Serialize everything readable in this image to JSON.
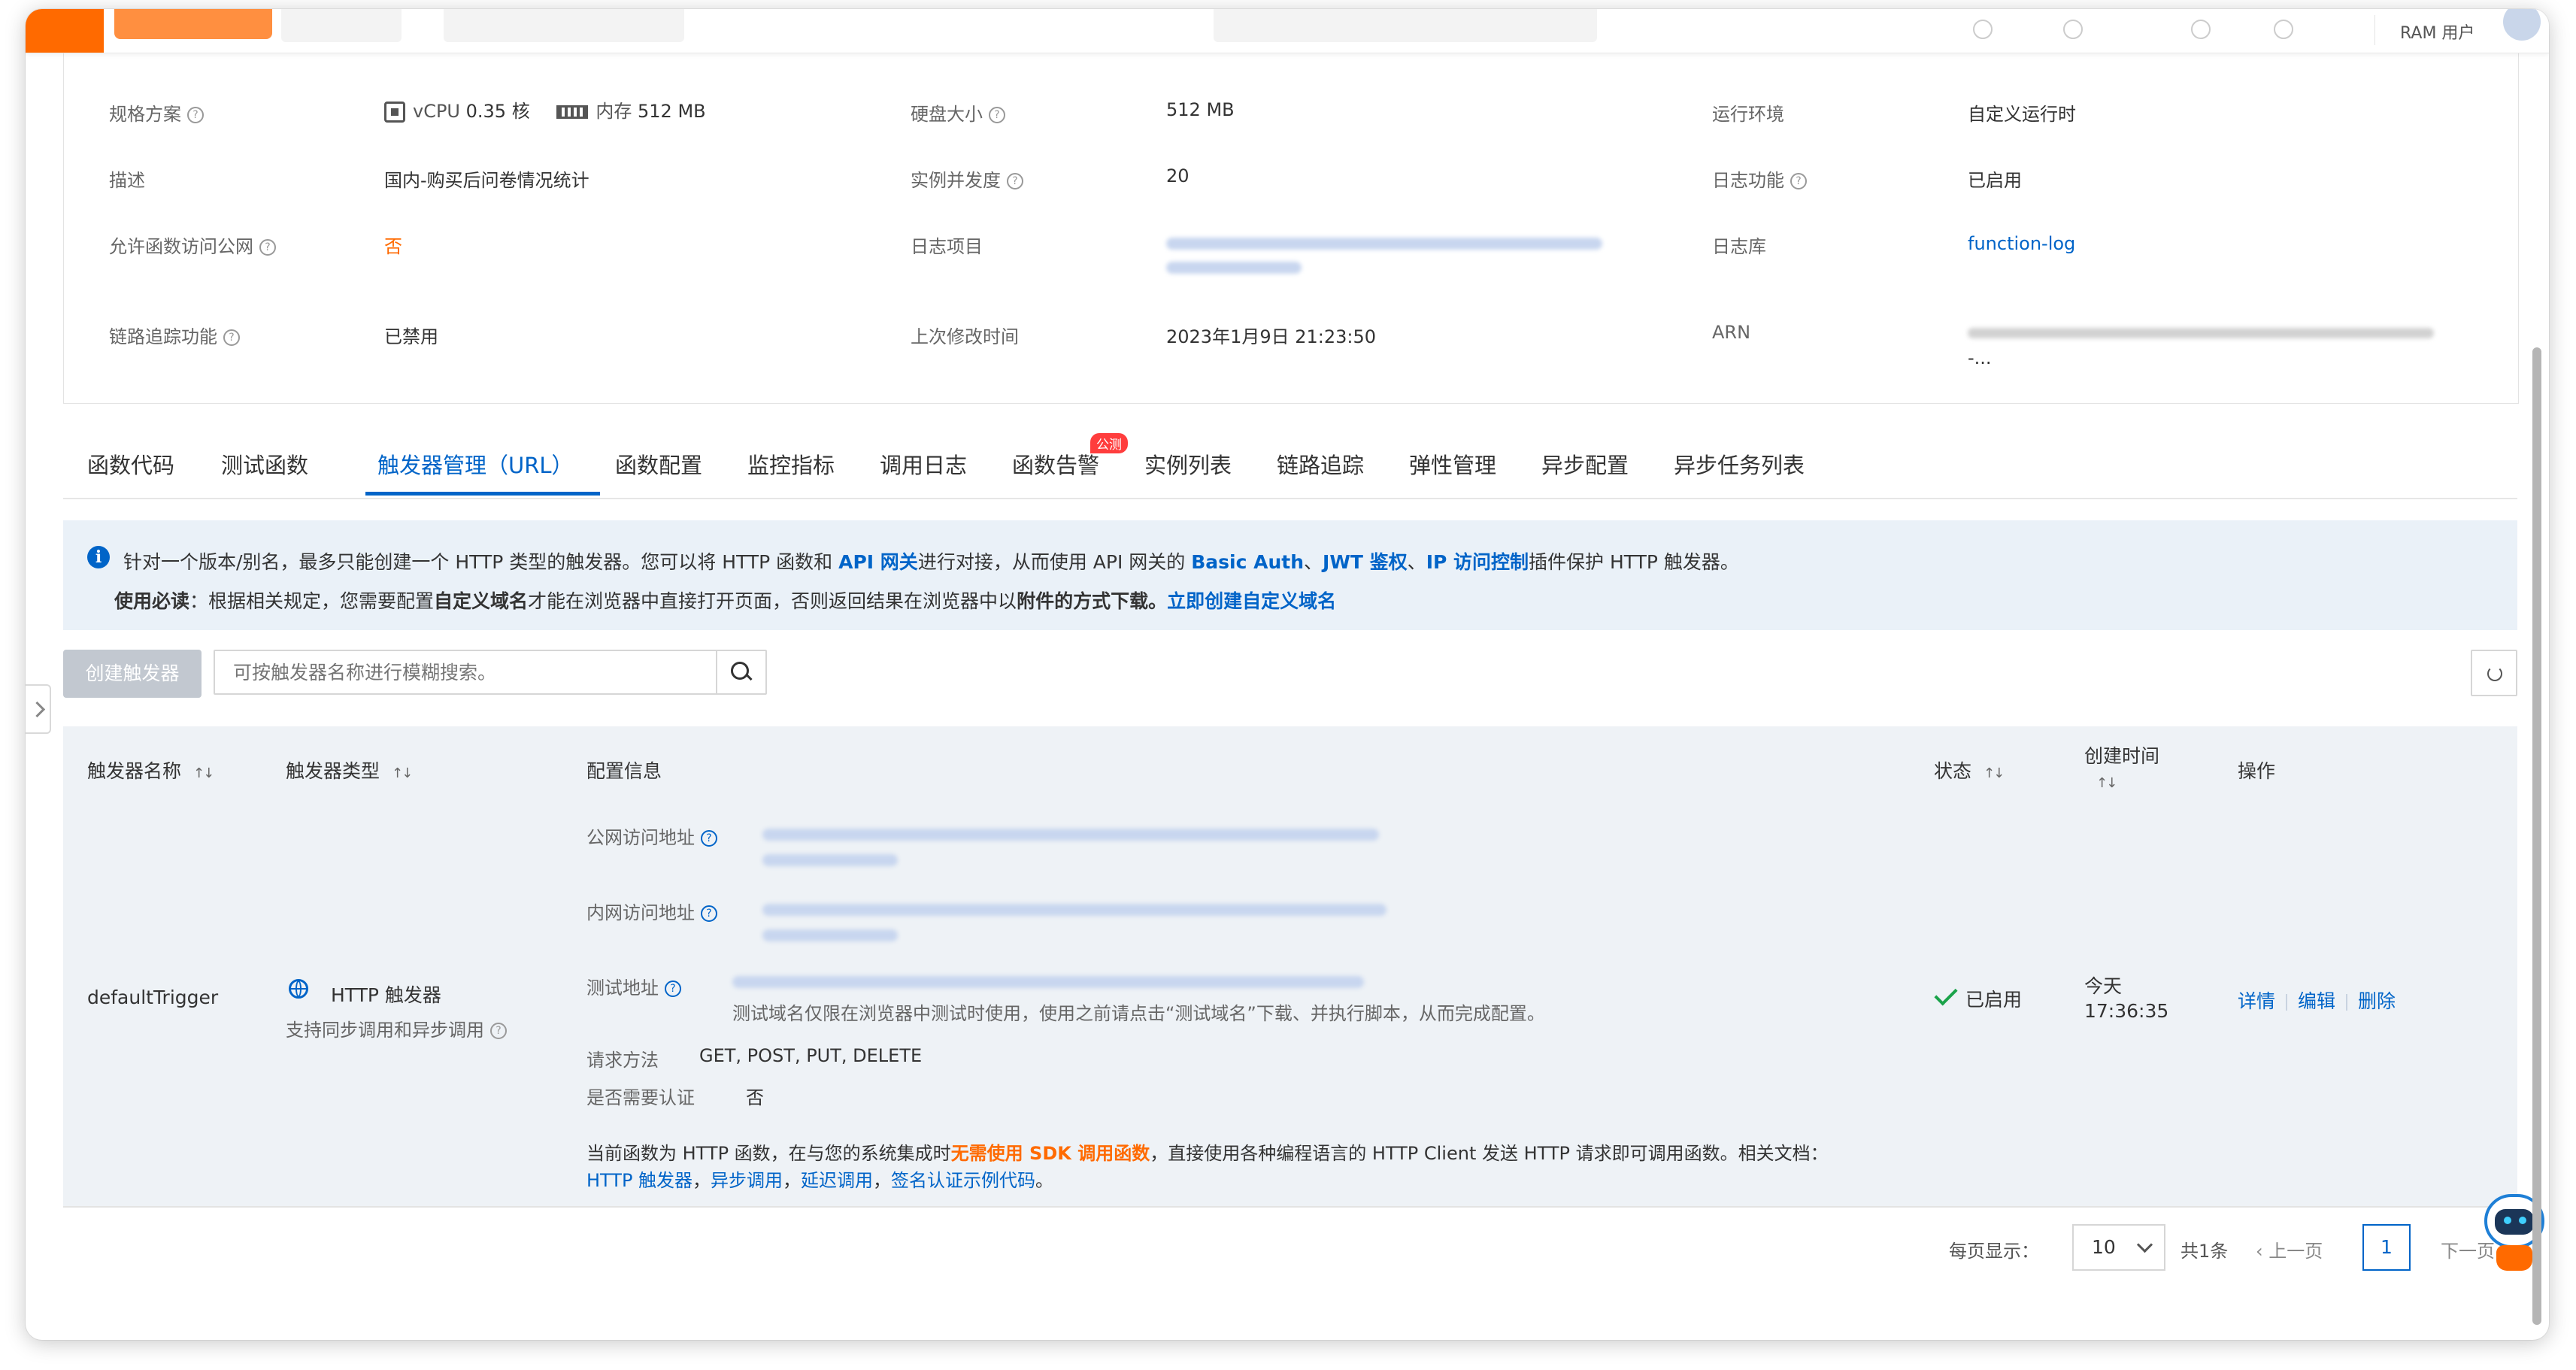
{
  "topbar": {
    "ram_user": "RAM 用户"
  },
  "info": {
    "spec_label": "规格方案",
    "vcpu_text": "vCPU",
    "vcpu_value": "0.35 核",
    "mem_text": "内存",
    "mem_value": "512 MB",
    "disk_label": "硬盘大小",
    "disk_value": "512 MB",
    "runtime_label": "运行环境",
    "runtime_value": "自定义运行时",
    "desc_label": "描述",
    "desc_value": "国内-购买后问卷情况统计",
    "concurrency_label": "实例并发度",
    "concurrency_value": "20",
    "log_label": "日志功能",
    "log_value": "已启用",
    "public_label": "允许函数访问公网",
    "public_value": "否",
    "log_project_label": "日志项目",
    "logstore_label": "日志库",
    "logstore_value": "function-log",
    "trace_label": "链路追踪功能",
    "trace_value": "已禁用",
    "modified_label": "上次修改时间",
    "modified_value": "2023年1月9日 21:23:50",
    "arn_label": "ARN",
    "arn_tail": "-..."
  },
  "tabs": [
    {
      "label": "函数代码"
    },
    {
      "label": "测试函数"
    },
    {
      "label": "触发器管理（URL）"
    },
    {
      "label": "函数配置"
    },
    {
      "label": "监控指标"
    },
    {
      "label": "调用日志"
    },
    {
      "label": "函数告警",
      "badge": "公测"
    },
    {
      "label": "实例列表"
    },
    {
      "label": "链路追踪"
    },
    {
      "label": "弹性管理"
    },
    {
      "label": "异步配置"
    },
    {
      "label": "异步任务列表"
    }
  ],
  "notice": {
    "l1_a": "针对一个版本/别名，最多只能创建一个 HTTP 类型的触发器。您可以将 HTTP 函数和 ",
    "l1_api": "API 网关",
    "l1_b": "进行对接，从而使用 API 网关的 ",
    "l1_basic": "Basic Auth",
    "l1_sep1": "、",
    "l1_jwt": "JWT 鉴权",
    "l1_sep2": "、",
    "l1_ip": "IP 访问控制",
    "l1_c": "插件保护 HTTP 触发器。",
    "l2_bold": "使用必读",
    "l2_a": "：根据相关规定，您需要配置",
    "l2_domain": "自定义域名",
    "l2_b": "才能在浏览器中直接打开页面，否则返回结果在浏览器中以",
    "l2_attach": "附件的方式下载。",
    "l2_link": "立即创建自定义域名"
  },
  "toolbar": {
    "create_label": "创建触发器",
    "search_placeholder": "可按触发器名称进行模糊搜索。"
  },
  "table": {
    "headers": {
      "name": "触发器名称",
      "type": "触发器类型",
      "config": "配置信息",
      "status": "状态",
      "created_l1": "创建时间",
      "ops": "操作"
    },
    "row": {
      "name": "defaultTrigger",
      "type": "HTTP 触发器",
      "type_sub": "支持同步调用和异步调用",
      "public_url_label": "公网访问地址",
      "private_url_label": "内网访问地址",
      "test_url_label": "测试地址",
      "test_note": "测试域名仅限在浏览器中测试时使用，使用之前请点击“测试域名”下载、并执行脚本，从而完成配置。",
      "methods_label": "请求方法",
      "methods_value": "GET, POST, PUT, DELETE",
      "auth_label": "是否需要认证",
      "auth_value": "否",
      "doc_a": "当前函数为 HTTP 函数，在与您的系统集成时",
      "doc_orange": "无需使用 SDK 调用函数",
      "doc_b": "，直接使用各种编程语言的 HTTP Client 发送 HTTP 请求即可调用函数。相关文档：",
      "doc_link1": "HTTP 触发器",
      "doc_comma1": "，",
      "doc_link2": "异步调用",
      "doc_comma2": "，",
      "doc_link3": "延迟调用",
      "doc_comma3": "，",
      "doc_link4": "签名认证示例代码",
      "doc_end": "。",
      "status": "已启用",
      "created_day": "今天",
      "created_time": "17:36:35",
      "op_detail": "详情",
      "op_edit": "编辑",
      "op_delete": "删除"
    }
  },
  "pagination": {
    "per_page_label": "每页显示：",
    "per_page_value": "10",
    "total": "共1条",
    "prev": "上一页",
    "current": "1",
    "next": "下一页"
  },
  "colors": {
    "primary": "#0064c8",
    "brand": "#ff6a00",
    "success": "#1aa34a"
  }
}
